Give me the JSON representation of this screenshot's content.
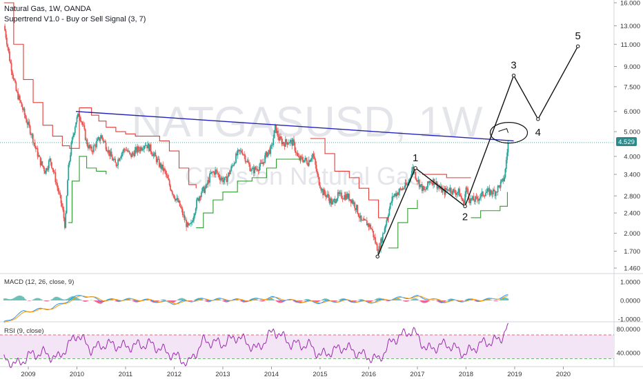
{
  "header": {
    "symbol_line": "Natural Gas, 1W, OANDA",
    "indicator_line": "Supertrend V1.0 - Buy or Sell Signal (3, 7)"
  },
  "watermark": {
    "ticker": "NATGASUSD, 1W",
    "subtitle": "CFDs on Natural Gas"
  },
  "price_badge": {
    "value": "4.529",
    "color": "#2a8a8c"
  },
  "panes": {
    "macd": {
      "label": "MACD (12, 26, close, 9)",
      "ticks": [
        "1.0000",
        "0.0000",
        "-1.0000"
      ]
    },
    "rsi": {
      "label": "RSI (9, close)",
      "ticks": [
        "80.0000",
        "40.0000"
      ]
    }
  },
  "colors": {
    "up": "#26a69a",
    "down": "#ef5350",
    "supertrend_up": "#2e9b2e",
    "supertrend_down": "#e53935",
    "trendline": "#2222bb",
    "macd": "#2196f3",
    "signal": "#ff9800",
    "rsi": "#9c27b0",
    "rsi_band": "#f3e5f5"
  },
  "chart_data": {
    "type": "candlestick",
    "title": "Natural Gas, 1W, OANDA",
    "x_axis": {
      "ticks": [
        "2009",
        "2010",
        "2011",
        "2012",
        "2013",
        "2014",
        "2015",
        "2016",
        "2017",
        "2018",
        "2019",
        "2020"
      ]
    },
    "y_axis": {
      "scale": "log",
      "ticks": [
        "16.000",
        "13.000",
        "11.000",
        "9.000",
        "7.500",
        "6.000",
        "5.000",
        "4.000",
        "3.400",
        "2.800",
        "2.400",
        "2.000",
        "1.700",
        "1.460"
      ],
      "ylim": [
        1.4,
        16.5
      ]
    },
    "close_path": [
      [
        2008.5,
        13.0
      ],
      [
        2008.62,
        9.5
      ],
      [
        2008.75,
        7.2
      ],
      [
        2008.85,
        6.4
      ],
      [
        2008.95,
        5.6
      ],
      [
        2009.05,
        5.0
      ],
      [
        2009.15,
        4.3
      ],
      [
        2009.25,
        3.8
      ],
      [
        2009.35,
        3.5
      ],
      [
        2009.45,
        3.9
      ],
      [
        2009.55,
        3.3
      ],
      [
        2009.62,
        2.9
      ],
      [
        2009.7,
        2.5
      ],
      [
        2009.76,
        2.1
      ],
      [
        2009.82,
        3.5
      ],
      [
        2009.9,
        4.6
      ],
      [
        2009.98,
        5.5
      ],
      [
        2010.05,
        5.9
      ],
      [
        2010.12,
        5.3
      ],
      [
        2010.2,
        4.5
      ],
      [
        2010.3,
        4.2
      ],
      [
        2010.4,
        4.5
      ],
      [
        2010.5,
        4.8
      ],
      [
        2010.6,
        4.4
      ],
      [
        2010.7,
        4.0
      ],
      [
        2010.8,
        3.7
      ],
      [
        2010.9,
        4.1
      ],
      [
        2011.0,
        4.3
      ],
      [
        2011.1,
        4.0
      ],
      [
        2011.2,
        4.2
      ],
      [
        2011.3,
        4.3
      ],
      [
        2011.4,
        4.5
      ],
      [
        2011.5,
        4.3
      ],
      [
        2011.6,
        4.0
      ],
      [
        2011.7,
        3.7
      ],
      [
        2011.8,
        3.5
      ],
      [
        2011.9,
        3.1
      ],
      [
        2012.0,
        2.8
      ],
      [
        2012.1,
        2.6
      ],
      [
        2012.2,
        2.3
      ],
      [
        2012.28,
        2.1
      ],
      [
        2012.35,
        2.15
      ],
      [
        2012.45,
        2.6
      ],
      [
        2012.55,
        2.9
      ],
      [
        2012.65,
        3.0
      ],
      [
        2012.75,
        3.4
      ],
      [
        2012.85,
        3.5
      ],
      [
        2012.95,
        3.3
      ],
      [
        2013.05,
        3.2
      ],
      [
        2013.15,
        3.5
      ],
      [
        2013.3,
        4.1
      ],
      [
        2013.4,
        4.2
      ],
      [
        2013.5,
        3.8
      ],
      [
        2013.6,
        3.5
      ],
      [
        2013.7,
        3.6
      ],
      [
        2013.8,
        3.7
      ],
      [
        2013.9,
        4.1
      ],
      [
        2014.0,
        4.3
      ],
      [
        2014.08,
        5.2
      ],
      [
        2014.15,
        4.7
      ],
      [
        2014.25,
        4.5
      ],
      [
        2014.35,
        4.6
      ],
      [
        2014.45,
        4.5
      ],
      [
        2014.55,
        3.9
      ],
      [
        2014.65,
        3.9
      ],
      [
        2014.75,
        3.8
      ],
      [
        2014.85,
        4.1
      ],
      [
        2014.95,
        3.3
      ],
      [
        2015.05,
        2.9
      ],
      [
        2015.15,
        2.8
      ],
      [
        2015.25,
        2.6
      ],
      [
        2015.35,
        2.8
      ],
      [
        2015.45,
        2.8
      ],
      [
        2015.55,
        2.8
      ],
      [
        2015.65,
        2.7
      ],
      [
        2015.75,
        2.5
      ],
      [
        2015.85,
        2.2
      ],
      [
        2015.95,
        2.2
      ],
      [
        2016.05,
        2.1
      ],
      [
        2016.15,
        1.8
      ],
      [
        2016.2,
        1.7
      ],
      [
        2016.3,
        2.0
      ],
      [
        2016.4,
        2.4
      ],
      [
        2016.5,
        2.8
      ],
      [
        2016.6,
        2.9
      ],
      [
        2016.7,
        3.0
      ],
      [
        2016.8,
        3.1
      ],
      [
        2016.9,
        3.6
      ],
      [
        2016.98,
        3.3
      ],
      [
        2017.05,
        3.1
      ],
      [
        2017.15,
        2.9
      ],
      [
        2017.25,
        3.2
      ],
      [
        2017.35,
        3.2
      ],
      [
        2017.45,
        3.0
      ],
      [
        2017.55,
        2.9
      ],
      [
        2017.65,
        3.0
      ],
      [
        2017.75,
        2.9
      ],
      [
        2017.85,
        2.9
      ],
      [
        2017.95,
        2.6
      ],
      [
        2018.0,
        3.0
      ],
      [
        2018.08,
        2.7
      ],
      [
        2018.2,
        2.7
      ],
      [
        2018.3,
        2.8
      ],
      [
        2018.4,
        2.9
      ],
      [
        2018.5,
        2.9
      ],
      [
        2018.6,
        2.9
      ],
      [
        2018.7,
        3.1
      ],
      [
        2018.76,
        3.2
      ],
      [
        2018.8,
        3.4
      ],
      [
        2018.84,
        4.1
      ],
      [
        2018.87,
        4.53
      ]
    ],
    "supertrend_down": [
      [
        2008.5,
        16.0
      ],
      [
        2008.7,
        11.0
      ],
      [
        2008.9,
        8.0
      ],
      [
        2009.1,
        6.5
      ],
      [
        2009.3,
        5.3
      ],
      [
        2009.5,
        4.8
      ],
      [
        2009.7,
        4.4
      ],
      [
        2009.85,
        4.3
      ],
      [
        2010.05,
        6.2
      ],
      [
        2010.3,
        5.8
      ],
      [
        2010.45,
        5.5
      ],
      [
        2010.6,
        5.2
      ],
      [
        2010.8,
        5.0
      ],
      [
        2011.0,
        4.9
      ],
      [
        2011.2,
        4.8
      ],
      [
        2011.7,
        4.6
      ],
      [
        2011.9,
        4.2
      ],
      [
        2012.1,
        3.6
      ],
      [
        2012.3,
        3.1
      ],
      [
        2012.45,
        3.0
      ],
      [
        2014.8,
        4.7
      ],
      [
        2015.1,
        4.1
      ],
      [
        2015.3,
        3.5
      ],
      [
        2015.6,
        3.3
      ],
      [
        2015.8,
        3.0
      ],
      [
        2016.0,
        2.7
      ],
      [
        2016.2,
        2.3
      ],
      [
        2016.4,
        2.2
      ],
      [
        2017.1,
        3.4
      ],
      [
        2017.3,
        3.4
      ],
      [
        2017.6,
        3.3
      ],
      [
        2017.8,
        3.3
      ],
      [
        2018.0,
        3.3
      ],
      [
        2018.1,
        3.3
      ]
    ],
    "supertrend_up": [
      [
        2009.82,
        2.2
      ],
      [
        2009.9,
        3.2
      ],
      [
        2010.05,
        4.0
      ],
      [
        2010.2,
        3.6
      ],
      [
        2010.4,
        3.5
      ],
      [
        2010.6,
        3.4
      ],
      [
        2012.45,
        2.1
      ],
      [
        2012.6,
        2.4
      ],
      [
        2012.8,
        2.7
      ],
      [
        2013.0,
        2.9
      ],
      [
        2013.3,
        3.2
      ],
      [
        2013.6,
        3.3
      ],
      [
        2013.9,
        3.6
      ],
      [
        2014.1,
        3.9
      ],
      [
        2014.4,
        3.9
      ],
      [
        2014.6,
        3.8
      ],
      [
        2016.4,
        1.75
      ],
      [
        2016.6,
        2.2
      ],
      [
        2016.8,
        2.5
      ],
      [
        2017.0,
        2.7
      ],
      [
        2018.1,
        2.3
      ],
      [
        2018.3,
        2.45
      ],
      [
        2018.5,
        2.45
      ],
      [
        2018.7,
        2.55
      ],
      [
        2018.85,
        2.9
      ]
    ],
    "trendline": [
      [
        2009.98,
        6.0
      ],
      [
        2018.98,
        4.6
      ]
    ],
    "wave_path": [
      [
        2016.18,
        1.62
      ],
      [
        2016.96,
        3.6
      ],
      [
        2017.98,
        2.55
      ],
      [
        2018.98,
        8.3
      ],
      [
        2019.48,
        5.6
      ],
      [
        2020.3,
        10.8
      ]
    ],
    "wave_labels": [
      {
        "label": "1",
        "x": 2016.96,
        "y": 3.6
      },
      {
        "label": "2",
        "x": 2017.98,
        "y": 2.55
      },
      {
        "label": "3",
        "x": 2018.98,
        "y": 8.3
      },
      {
        "label": "4",
        "x": 2019.48,
        "y": 5.6
      },
      {
        "label": "5",
        "x": 2020.3,
        "y": 10.8
      }
    ],
    "annotation_ellipse": {
      "x": 2018.88,
      "y": 4.95
    },
    "macd": {
      "macd_path": [
        [
          2008.5,
          -1.2
        ],
        [
          2008.9,
          -0.6
        ],
        [
          2009.5,
          -0.4
        ],
        [
          2009.9,
          0.1
        ],
        [
          2010.1,
          0.3
        ],
        [
          2010.5,
          0.0
        ],
        [
          2011.0,
          0.05
        ],
        [
          2011.5,
          0.0
        ],
        [
          2012.0,
          -0.15
        ],
        [
          2012.5,
          0.05
        ],
        [
          2013.0,
          0.05
        ],
        [
          2013.5,
          0.0
        ],
        [
          2014.0,
          0.15
        ],
        [
          2014.5,
          -0.05
        ],
        [
          2015.0,
          -0.1
        ],
        [
          2015.5,
          0.0
        ],
        [
          2016.0,
          -0.1
        ],
        [
          2016.5,
          0.1
        ],
        [
          2017.0,
          0.2
        ],
        [
          2017.5,
          -0.05
        ],
        [
          2018.0,
          0.0
        ],
        [
          2018.5,
          0.05
        ],
        [
          2018.87,
          0.25
        ]
      ]
    },
    "rsi": {
      "upper": 70,
      "lower": 30,
      "path": [
        [
          2008.5,
          28
        ],
        [
          2008.8,
          20
        ],
        [
          2009.0,
          35
        ],
        [
          2009.3,
          40
        ],
        [
          2009.6,
          30
        ],
        [
          2009.85,
          55
        ],
        [
          2010.0,
          72
        ],
        [
          2010.3,
          45
        ],
        [
          2010.6,
          55
        ],
        [
          2011.0,
          50
        ],
        [
          2011.5,
          55
        ],
        [
          2012.0,
          35
        ],
        [
          2012.3,
          22
        ],
        [
          2012.6,
          60
        ],
        [
          2013.0,
          55
        ],
        [
          2013.3,
          68
        ],
        [
          2013.7,
          45
        ],
        [
          2014.05,
          78
        ],
        [
          2014.4,
          55
        ],
        [
          2014.8,
          52
        ],
        [
          2015.0,
          35
        ],
        [
          2015.5,
          50
        ],
        [
          2015.9,
          35
        ],
        [
          2016.2,
          28
        ],
        [
          2016.5,
          62
        ],
        [
          2016.9,
          78
        ],
        [
          2017.2,
          45
        ],
        [
          2017.6,
          55
        ],
        [
          2017.98,
          38
        ],
        [
          2018.3,
          55
        ],
        [
          2018.7,
          62
        ],
        [
          2018.87,
          88
        ]
      ]
    }
  }
}
